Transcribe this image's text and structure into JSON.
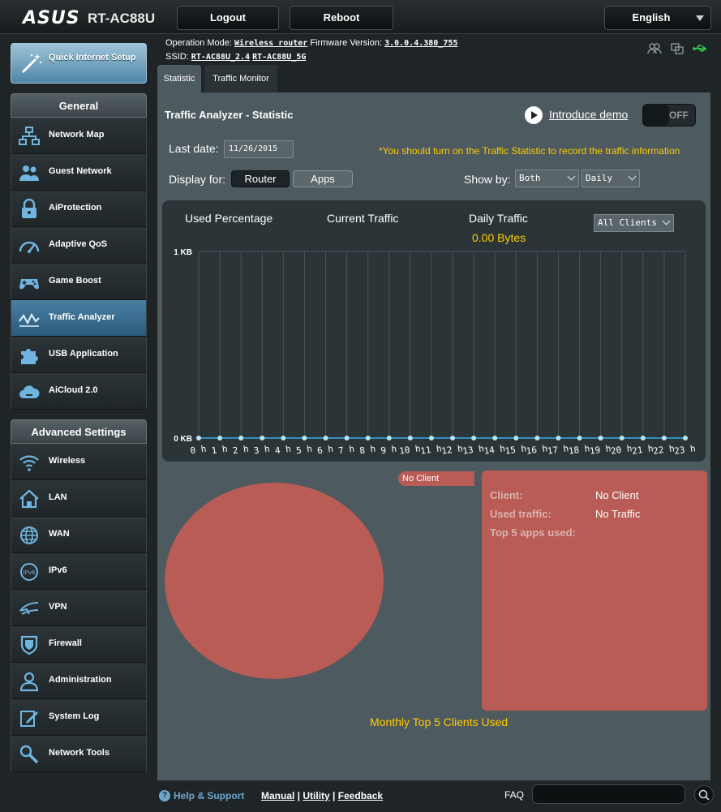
{
  "header": {
    "brand": "ASUS",
    "model": "RT-AC88U",
    "logout_label": "Logout",
    "reboot_label": "Reboot",
    "language": "English"
  },
  "status": {
    "op_mode_label": "Operation Mode:",
    "op_mode_value": "Wireless router",
    "firmware_label": "Firmware Version:",
    "firmware_value": "3.0.0.4.380_755",
    "ssid_label": "SSID:",
    "ssid_24": "RT-AC88U_2.4",
    "ssid_5": "RT-AC88U_5G"
  },
  "sidebar": {
    "qis_label": "Quick Internet Setup",
    "general_header": "General",
    "general_items": [
      {
        "label": "Network Map",
        "icon": "network-map-icon"
      },
      {
        "label": "Guest Network",
        "icon": "guest-network-icon"
      },
      {
        "label": "AiProtection",
        "icon": "lock-icon"
      },
      {
        "label": "Adaptive QoS",
        "icon": "gauge-icon"
      },
      {
        "label": "Game Boost",
        "icon": "gamepad-icon"
      },
      {
        "label": "Traffic Analyzer",
        "icon": "traffic-icon"
      },
      {
        "label": "USB Application",
        "icon": "puzzle-icon"
      },
      {
        "label": "AiCloud 2.0",
        "icon": "cloud-icon"
      }
    ],
    "advanced_header": "Advanced Settings",
    "advanced_items": [
      {
        "label": "Wireless",
        "icon": "wifi-icon"
      },
      {
        "label": "LAN",
        "icon": "house-icon"
      },
      {
        "label": "WAN",
        "icon": "globe-icon"
      },
      {
        "label": "IPv6",
        "icon": "ipv6-icon"
      },
      {
        "label": "VPN",
        "icon": "vpn-icon"
      },
      {
        "label": "Firewall",
        "icon": "shield-icon"
      },
      {
        "label": "Administration",
        "icon": "admin-user-icon"
      },
      {
        "label": "System Log",
        "icon": "log-icon"
      },
      {
        "label": "Network Tools",
        "icon": "tools-icon"
      }
    ]
  },
  "tabs": {
    "statistic": "Statistic",
    "monitor": "Traffic Monitor"
  },
  "main": {
    "title": "Traffic Analyzer - Statistic",
    "demo_label": "Introduce demo",
    "toggle_state": "OFF",
    "last_date_label": "Last date:",
    "last_date_value": "11/26/2015",
    "hint": "*You should turn on the Traffic Statistic to record the traffic information",
    "display_for_label": "Display for:",
    "router_label": "Router",
    "apps_label": "Apps",
    "show_by_label": "Show by:",
    "show_by_value": "Both",
    "period_value": "Daily",
    "used_percentage": "Used Percentage",
    "current_traffic": "Current Traffic",
    "daily_traffic": "Daily Traffic",
    "daily_traffic_value": "0.00 Bytes",
    "clients_value": "All Clients",
    "no_client_badge": "No Client",
    "client_label": "Client:",
    "client_value": "No Client",
    "used_traffic_label": "Used traffic:",
    "used_traffic_value": "No Traffic",
    "top5_label": "Top 5 apps used:",
    "monthly_label": "Monthly Top 5 Clients Used"
  },
  "chart_data": {
    "type": "line",
    "x": [
      "0 h",
      "1 h",
      "2 h",
      "3 h",
      "4 h",
      "5 h",
      "6 h",
      "7 h",
      "8 h",
      "9 h",
      "10 h",
      "11 h",
      "12 h",
      "13 h",
      "14 h",
      "15 h",
      "16 h",
      "17 h",
      "18 h",
      "19 h",
      "20 h",
      "21 h",
      "22 h",
      "23 h"
    ],
    "series": [
      {
        "values": [
          0,
          0,
          0,
          0,
          0,
          0,
          0,
          0,
          0,
          0,
          0,
          0,
          0,
          0,
          0,
          0,
          0,
          0,
          0,
          0,
          0,
          0,
          0,
          0
        ]
      }
    ],
    "y_ticks": [
      "0 KB",
      "1 KB"
    ],
    "ylim": [
      0,
      1
    ],
    "grid": true,
    "line_color": "#2d8fc4",
    "point_color": "#bfe3f7"
  },
  "footer": {
    "help": "Help & Support",
    "manual": "Manual",
    "utility": "Utility",
    "feedback": "Feedback",
    "faq": "FAQ"
  },
  "colors": {
    "accent_yellow": "#ffcc00",
    "panel": "#4d5a5f",
    "pie": "#b85c55",
    "active_menu": "#3d7398"
  }
}
